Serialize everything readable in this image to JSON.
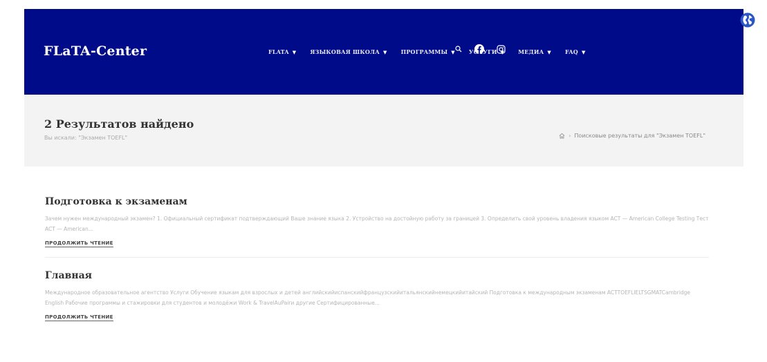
{
  "header": {
    "logo": "FLaTA-Center",
    "nav": [
      {
        "label": "FLATA"
      },
      {
        "label": "ЯЗЫКОВАЯ ШКОЛА"
      },
      {
        "label": "ПРОГРАММЫ"
      },
      {
        "label": "УСЛУГИ"
      },
      {
        "label": "МЕДИА"
      },
      {
        "label": "FAQ"
      }
    ],
    "icons": [
      "search-icon",
      "facebook-icon",
      "instagram-icon"
    ],
    "background": "#000b8a"
  },
  "language_icon": "globe-icon",
  "title_band": {
    "title": "2 Результатов найдено",
    "subtitle": "Вы искали: \"Экзамен TOEFL\"",
    "breadcrumb": {
      "home_icon": "home-icon",
      "separator": "›",
      "current": "Поисковые результаты для \"Экзамен TOEFL\""
    }
  },
  "results": [
    {
      "title": "Подготовка к экзаменам",
      "excerpt": "Зачем нужен международный экзамен? 1. Официальный сертификат подтверждающий Ваше знание языка 2. Устройство на достойную работу за границей 3. Определить свой уровень владения языком ACT — American College Testing Тест ACT — American...",
      "read_more": "ПРОДОЛЖИТЬ ЧТЕНИЕ"
    },
    {
      "title": "Главная",
      "excerpt": "Международное образовательное агентство Услуги Обучение языкам для взрослых и детей английскийиспанскийфранцузскийитальянскийнемецкийитайский Подготовка к международным экзаменам ACTTOEFLIELTSGMATCambridge English Рабочие программы и стажировки для студентов и молодёжи Work & TravelAuPairи другие Сертифицированные...",
      "read_more": "ПРОДОЛЖИТЬ ЧТЕНИЕ"
    }
  ]
}
